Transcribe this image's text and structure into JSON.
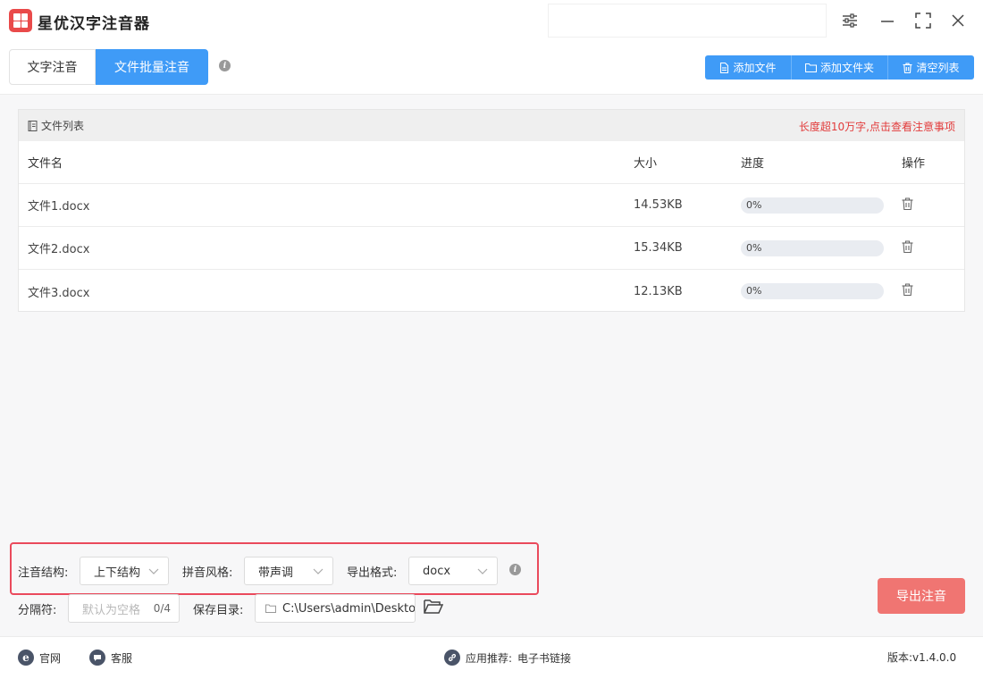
{
  "app": {
    "title": "星优汉字注音器",
    "brand_color": "#e94a4a",
    "accent_color": "#3f9bf7"
  },
  "window_controls": [
    "settings-sliders-icon",
    "minimize-icon",
    "maximize-icon",
    "close-icon"
  ],
  "tabs": [
    {
      "label": "文字注音",
      "active": false
    },
    {
      "label": "文件批量注音",
      "active": true
    }
  ],
  "toolbar": {
    "add_file": "添加文件",
    "add_folder": "添加文件夹",
    "clear_list": "清空列表"
  },
  "file_list": {
    "title": "文件列表",
    "notice": "长度超10万字,点击查看注意事项",
    "columns": {
      "name": "文件名",
      "size": "大小",
      "progress": "进度",
      "action": "操作"
    },
    "rows": [
      {
        "name": "文件1.docx",
        "size": "14.53KB",
        "progress": "0%",
        "progress_value": 0
      },
      {
        "name": "文件2.docx",
        "size": "15.34KB",
        "progress": "0%",
        "progress_value": 0
      },
      {
        "name": "文件3.docx",
        "size": "12.13KB",
        "progress": "0%",
        "progress_value": 0
      }
    ]
  },
  "options": {
    "structure_label": "注音结构:",
    "structure_value": "上下结构",
    "style_label": "拼音风格:",
    "style_value": "带声调",
    "format_label": "导出格式:",
    "format_value": "docx",
    "separator_label": "分隔符:",
    "separator_placeholder": "默认为空格",
    "separator_count": "0/4",
    "save_label": "保存目录:",
    "save_path": "C:\\Users\\admin\\Deskto"
  },
  "export_button": "导出注音",
  "footer": {
    "website": "官网",
    "service": "客服",
    "recommend_label": "应用推荐:",
    "recommend_link": "电子书链接",
    "version": "版本:v1.4.0.0"
  }
}
